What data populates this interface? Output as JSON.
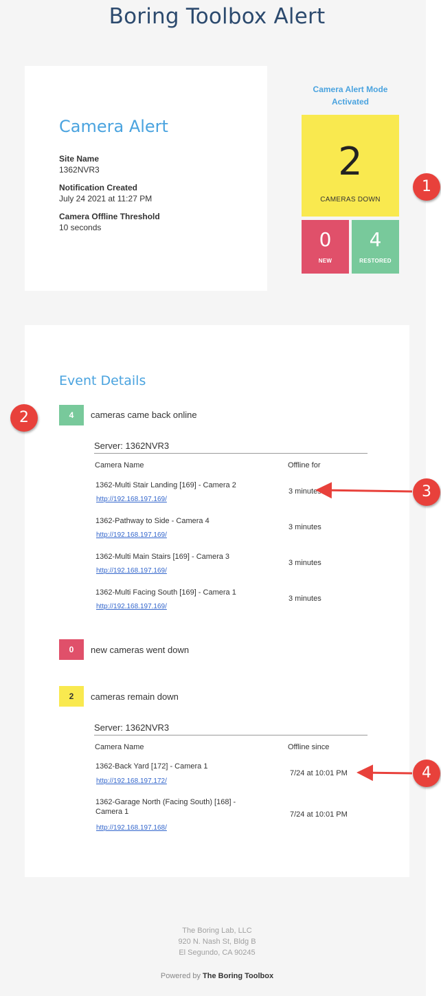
{
  "title": "Boring Toolbox Alert",
  "alert_card": {
    "heading": "Camera Alert",
    "site_label": "Site Name",
    "site_value": "1362NVR3",
    "created_label": "Notification Created",
    "created_value": "July 24 2021 at 11:27 PM",
    "threshold_label": "Camera Offline Threshold",
    "threshold_value": "10 seconds"
  },
  "mode": {
    "line1": "Camera Alert Mode",
    "line2": "Activated"
  },
  "tiles": {
    "down_count": "2",
    "down_label": "CAMERAS DOWN",
    "new_count": "0",
    "new_label": "NEW",
    "restored_count": "4",
    "restored_label": "RESTORED"
  },
  "callouts": [
    "1",
    "2",
    "3",
    "4"
  ],
  "events": {
    "heading": "Event Details",
    "restored": {
      "count": "4",
      "label": "cameras came back online",
      "server": "Server: 1362NVR3",
      "col_name": "Camera Name",
      "col_value": "Offline for",
      "rows": [
        {
          "name": "1362-Multi Stair Landing [169] - Camera 2",
          "link": "http://192.168.197.169/",
          "value": "3 minutes"
        },
        {
          "name": "1362-Pathway to Side - Camera 4",
          "link": "http://192.168.197.169/",
          "value": "3 minutes"
        },
        {
          "name": "1362-Multi Main Stairs [169] - Camera 3",
          "link": "http://192.168.197.169/",
          "value": "3 minutes"
        },
        {
          "name": "1362-Multi Facing South [169] - Camera 1",
          "link": "http://192.168.197.169/",
          "value": "3 minutes"
        }
      ]
    },
    "new_down": {
      "count": "0",
      "label": "new cameras went down"
    },
    "remain_down": {
      "count": "2",
      "label": "cameras remain down",
      "server": "Server: 1362NVR3",
      "col_name": "Camera Name",
      "col_value": "Offline since",
      "rows": [
        {
          "name": "1362-Back Yard [172] - Camera 1",
          "link": "http://192.168.197.172/",
          "value": "7/24 at 10:01 PM"
        },
        {
          "name": "1362-Garage North (Facing South) [168] - Camera 1",
          "link": "http://192.168.197.168/",
          "value": "7/24 at 10:01 PM"
        }
      ]
    }
  },
  "footer": {
    "line1": "The Boring Lab, LLC",
    "line2": "920 N. Nash St, Bldg B",
    "line3": "El Segundo, CA 90245",
    "powered_prefix": "Powered by",
    "powered_brand": "The Boring Toolbox"
  },
  "colors": {
    "accent": "#4aa3df",
    "down": "#f9e94f",
    "new": "#e0506a",
    "restored": "#78c99b",
    "callout": "#e8413b"
  }
}
